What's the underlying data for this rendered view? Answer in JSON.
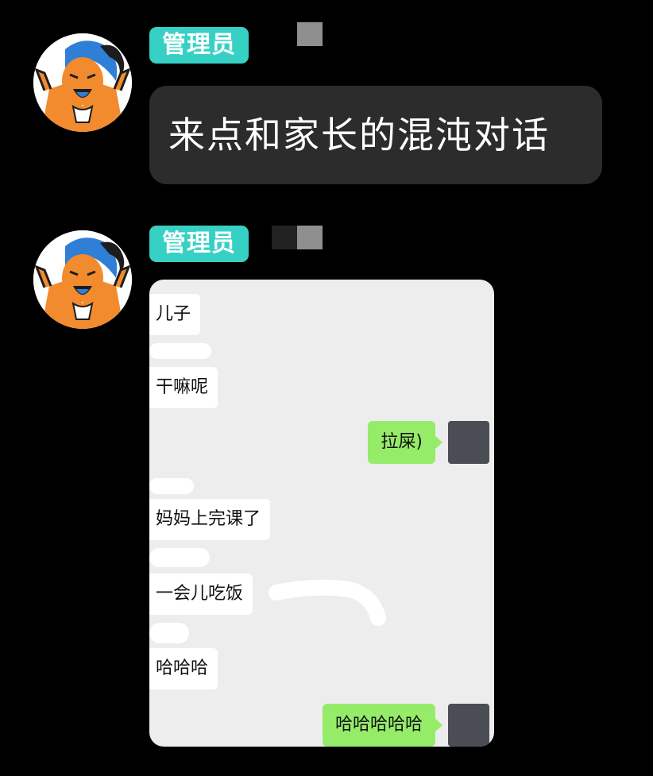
{
  "messages": [
    {
      "sender_badge": "管理员",
      "text": "来点和家长的混沌对话"
    },
    {
      "sender_badge": "管理员",
      "screenshot": {
        "chat": [
          {
            "side": "in",
            "text": "儿子"
          },
          {
            "side": "in",
            "text": "干嘛呢"
          },
          {
            "side": "out",
            "text": "拉屎)"
          },
          {
            "side": "in",
            "text": "妈妈上完课了"
          },
          {
            "side": "in",
            "text": "一会儿吃饭"
          },
          {
            "side": "in",
            "text": "哈哈哈"
          },
          {
            "side": "out",
            "text": "哈哈哈哈哈"
          }
        ]
      }
    }
  ],
  "colors": {
    "background": "#000000",
    "badge": "#36d1c4",
    "text_bubble": "#2c2c2c",
    "outgoing_bubble": "#95ec69",
    "incoming_bubble": "#ffffff",
    "screenshot_bg": "#ededed"
  },
  "icons": {
    "avatar": "cartoon-boy-avatar-icon",
    "mini_avatar": "placeholder-avatar-icon"
  }
}
